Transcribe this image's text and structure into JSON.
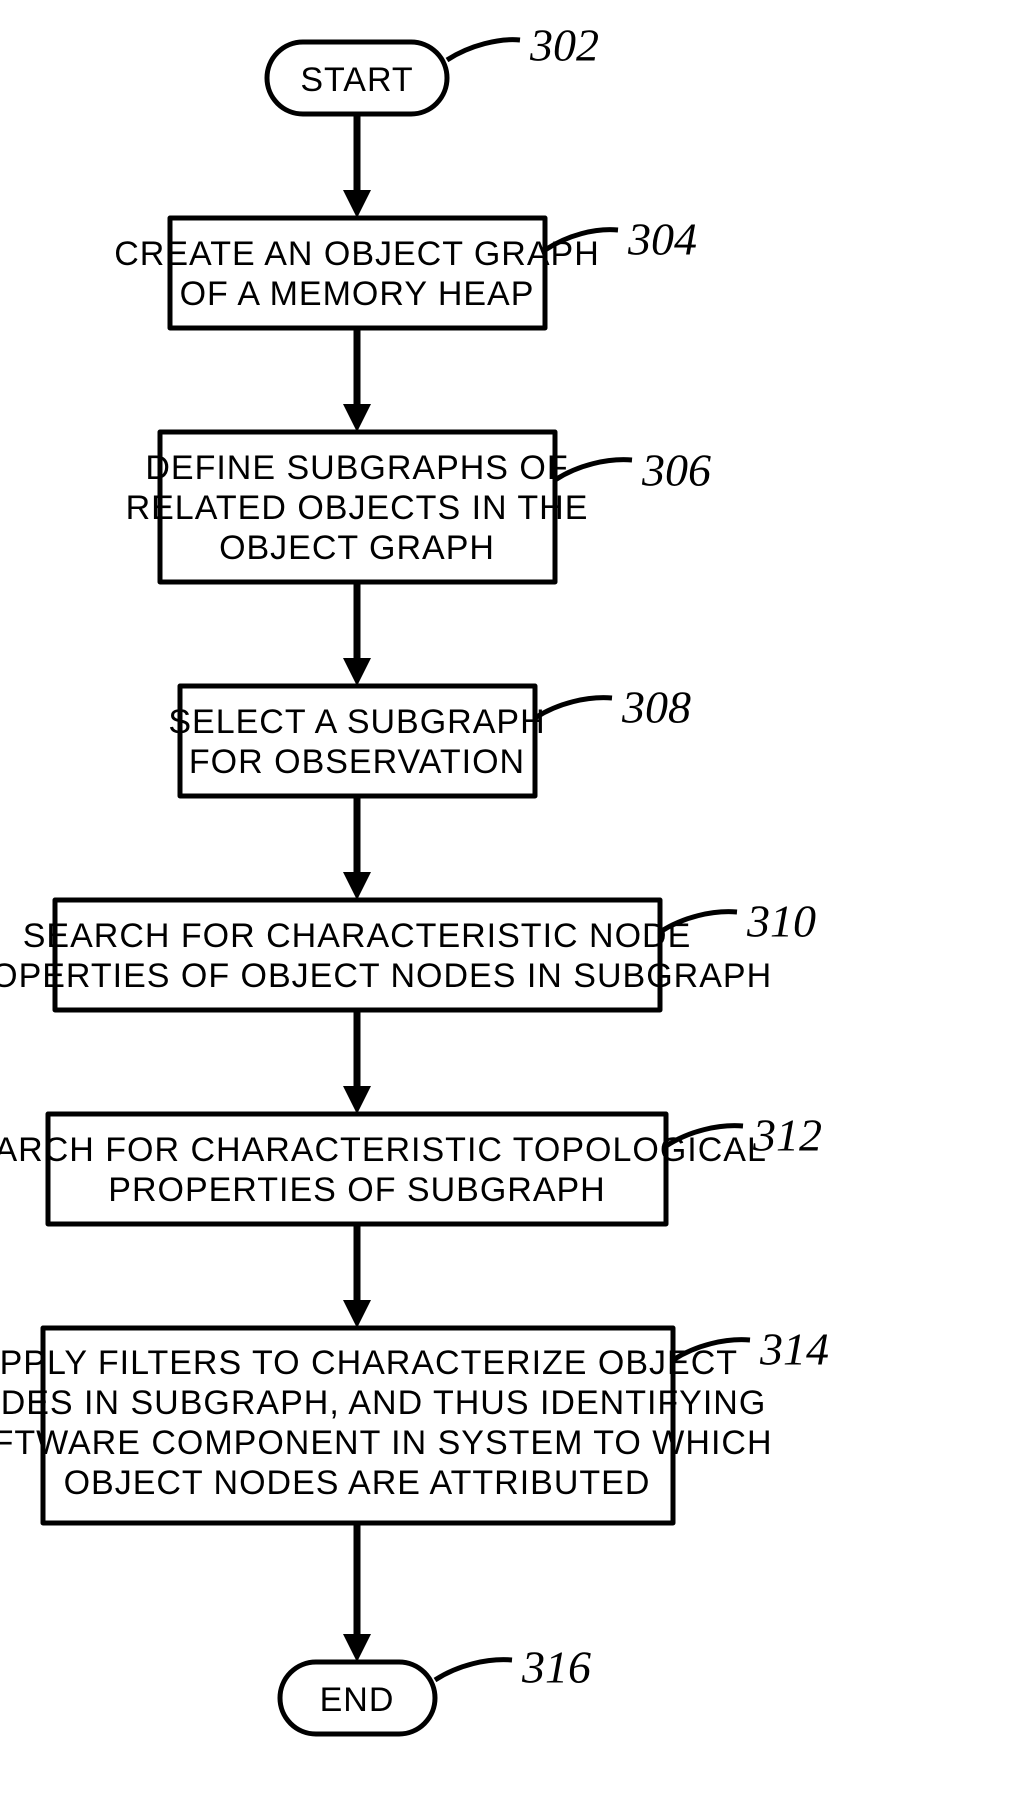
{
  "chart_data": {
    "type": "flowchart",
    "nodes": [
      {
        "id": "302",
        "kind": "terminator",
        "text": "START",
        "ref": "302"
      },
      {
        "id": "304",
        "kind": "process",
        "text": "CREATE AN OBJECT GRAPH OF A MEMORY HEAP",
        "ref": "304"
      },
      {
        "id": "306",
        "kind": "process",
        "text": "DEFINE SUBGRAPHS OF RELATED OBJECTS IN THE OBJECT GRAPH",
        "ref": "306"
      },
      {
        "id": "308",
        "kind": "process",
        "text": "SELECT A SUBGRAPH FOR OBSERVATION",
        "ref": "308"
      },
      {
        "id": "310",
        "kind": "process",
        "text": "SEARCH FOR CHARACTERISTIC NODE PROPERTIES OF OBJECT NODES IN SUBGRAPH",
        "ref": "310"
      },
      {
        "id": "312",
        "kind": "process",
        "text": "SEARCH FOR CHARACTERISTIC TOPOLOGICAL PROPERTIES OF SUBGRAPH",
        "ref": "312"
      },
      {
        "id": "314",
        "kind": "process",
        "text": "APPLY FILTERS TO CHARACTERIZE OBJECT NODES IN SUBGRAPH, AND THUS IDENTIFYING SOFTWARE COMPONENT IN SYSTEM TO WHICH OBJECT NODES ARE ATTRIBUTED",
        "ref": "314"
      },
      {
        "id": "316",
        "kind": "terminator",
        "text": "END",
        "ref": "316"
      }
    ],
    "edges": [
      {
        "from": "302",
        "to": "304"
      },
      {
        "from": "304",
        "to": "306"
      },
      {
        "from": "306",
        "to": "308"
      },
      {
        "from": "308",
        "to": "310"
      },
      {
        "from": "310",
        "to": "312"
      },
      {
        "from": "312",
        "to": "314"
      },
      {
        "from": "314",
        "to": "316"
      }
    ]
  },
  "start": {
    "text": "START",
    "ref": "302"
  },
  "step304": {
    "line1": "CREATE AN OBJECT GRAPH",
    "line2": "OF A MEMORY HEAP",
    "ref": "304"
  },
  "step306": {
    "line1": "DEFINE SUBGRAPHS OF",
    "line2": "RELATED OBJECTS IN THE",
    "line3": "OBJECT GRAPH",
    "ref": "306"
  },
  "step308": {
    "line1": "SELECT A SUBGRAPH",
    "line2": "FOR OBSERVATION",
    "ref": "308"
  },
  "step310": {
    "line1": "SEARCH FOR CHARACTERISTIC NODE",
    "line2": "PROPERTIES OF OBJECT NODES IN SUBGRAPH",
    "ref": "310"
  },
  "step312": {
    "line1": "SEARCH FOR CHARACTERISTIC TOPOLOGICAL",
    "line2": "PROPERTIES OF SUBGRAPH",
    "ref": "312"
  },
  "step314": {
    "line1": "APPLY FILTERS TO CHARACTERIZE OBJECT",
    "line2": "NODES IN SUBGRAPH, AND THUS IDENTIFYING",
    "line3": "SOFTWARE COMPONENT IN SYSTEM TO WHICH",
    "line4": "OBJECT NODES ARE ATTRIBUTED",
    "ref": "314"
  },
  "end": {
    "text": "END",
    "ref": "316"
  }
}
